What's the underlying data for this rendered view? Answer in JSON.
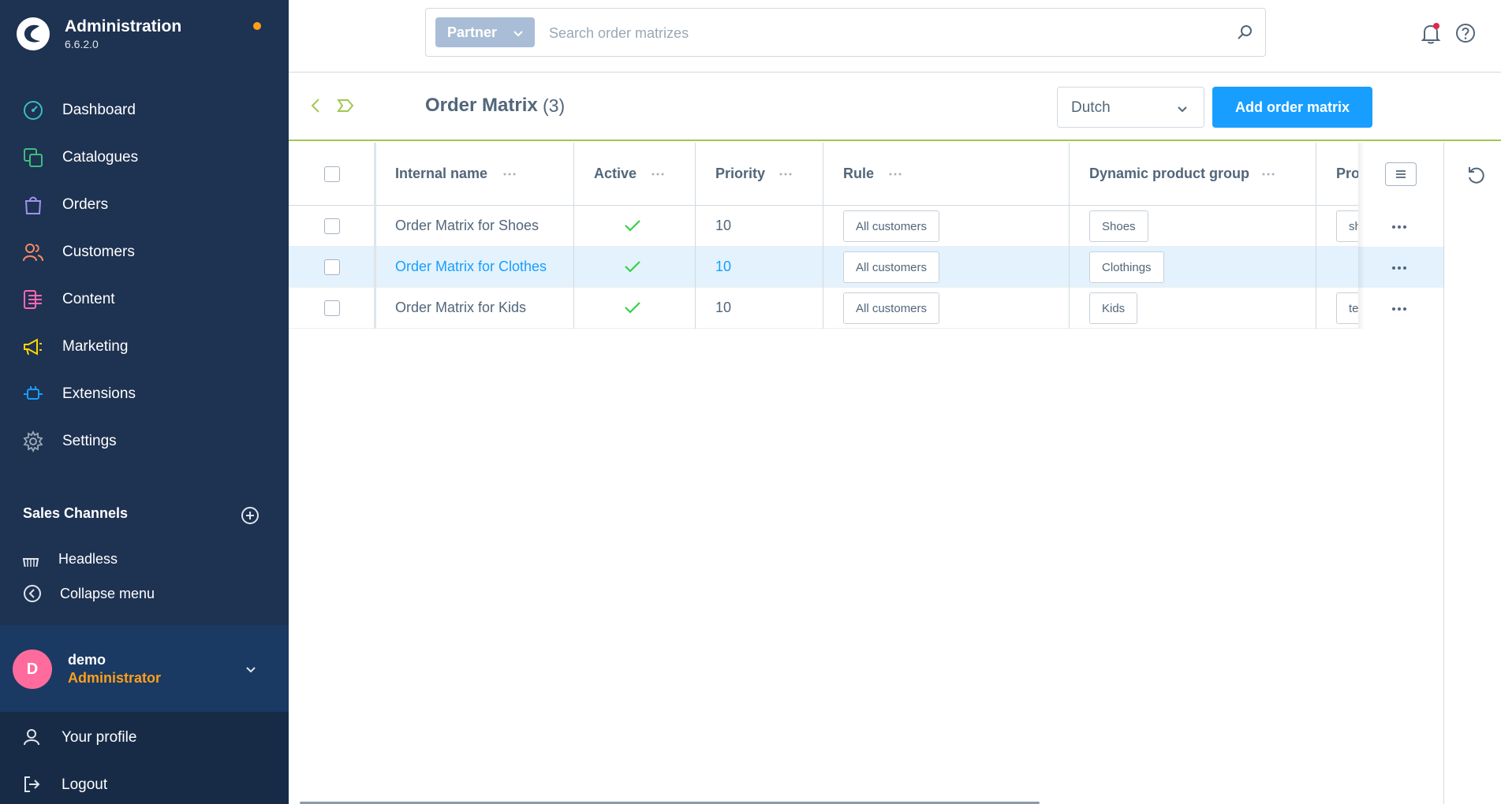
{
  "app": {
    "title": "Administration",
    "version": "6.6.2.0",
    "status_dot_color": "#ff9f1a"
  },
  "sidebar": {
    "items": [
      {
        "label": "Dashboard",
        "icon": "dashboard-icon",
        "color": "#38bdc5"
      },
      {
        "label": "Catalogues",
        "icon": "catalogues-icon",
        "color": "#3dbd7d"
      },
      {
        "label": "Orders",
        "icon": "orders-icon",
        "color": "#a092f0"
      },
      {
        "label": "Customers",
        "icon": "customers-icon",
        "color": "#f88962"
      },
      {
        "label": "Content",
        "icon": "content-icon",
        "color": "#ff68b4"
      },
      {
        "label": "Marketing",
        "icon": "marketing-icon",
        "color": "#ffd700"
      },
      {
        "label": "Extensions",
        "icon": "extensions-icon",
        "color": "#189eff"
      },
      {
        "label": "Settings",
        "icon": "settings-icon",
        "color": "#9aa8b5"
      }
    ],
    "sales_channels": {
      "header": "Sales Channels",
      "items": [
        {
          "label": "Headless",
          "icon": "basket-icon"
        }
      ]
    },
    "collapse_label": "Collapse menu",
    "user": {
      "initial": "D",
      "name": "demo",
      "role": "Administrator"
    },
    "account": [
      {
        "label": "Your profile",
        "icon": "user-icon"
      },
      {
        "label": "Logout",
        "icon": "logout-icon"
      }
    ]
  },
  "topbar": {
    "entity_label": "Partner",
    "search_placeholder": "Search order matrizes"
  },
  "smartbar": {
    "title": "Order Matrix",
    "count": "(3)",
    "language": "Dutch",
    "add_button": "Add order matrix"
  },
  "grid": {
    "columns": [
      "Internal name",
      "Active",
      "Priority",
      "Rule",
      "Dynamic product group",
      "Pro"
    ],
    "rows": [
      {
        "name": "Order Matrix for Shoes",
        "active": true,
        "priority": "10",
        "rule": "All customers",
        "group": "Shoes",
        "extra": "sh",
        "highlight": false
      },
      {
        "name": "Order Matrix for Clothes",
        "active": true,
        "priority": "10",
        "rule": "All customers",
        "group": "Clothings",
        "extra": "",
        "highlight": true
      },
      {
        "name": "Order Matrix for Kids",
        "active": true,
        "priority": "10",
        "rule": "All customers",
        "group": "Kids",
        "extra": "te",
        "highlight": false
      }
    ]
  }
}
